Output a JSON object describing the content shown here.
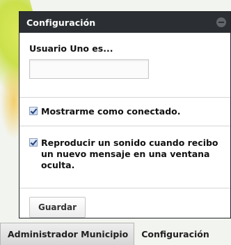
{
  "panel": {
    "title": "Configuración",
    "user_field": {
      "label": "Usuario Uno es...",
      "value": "",
      "placeholder": ""
    },
    "options": [
      {
        "checked": true,
        "label": "Mostrarme como conectado."
      },
      {
        "checked": true,
        "label": "Reproducir un sonido cuando recibo un nuevo mensaje en una ventana oculta."
      }
    ],
    "save_label": "Guardar"
  },
  "taskbar": {
    "tabs": [
      {
        "label": "Administrador Municipio"
      },
      {
        "label": "Configuración"
      }
    ]
  },
  "icons": {
    "collapse": "collapse-icon",
    "checkbox": "checkbox-checked-icon"
  },
  "colors": {
    "header_bg": "#2b2f33",
    "panel_bg": "#ffffff",
    "text": "#111111"
  }
}
